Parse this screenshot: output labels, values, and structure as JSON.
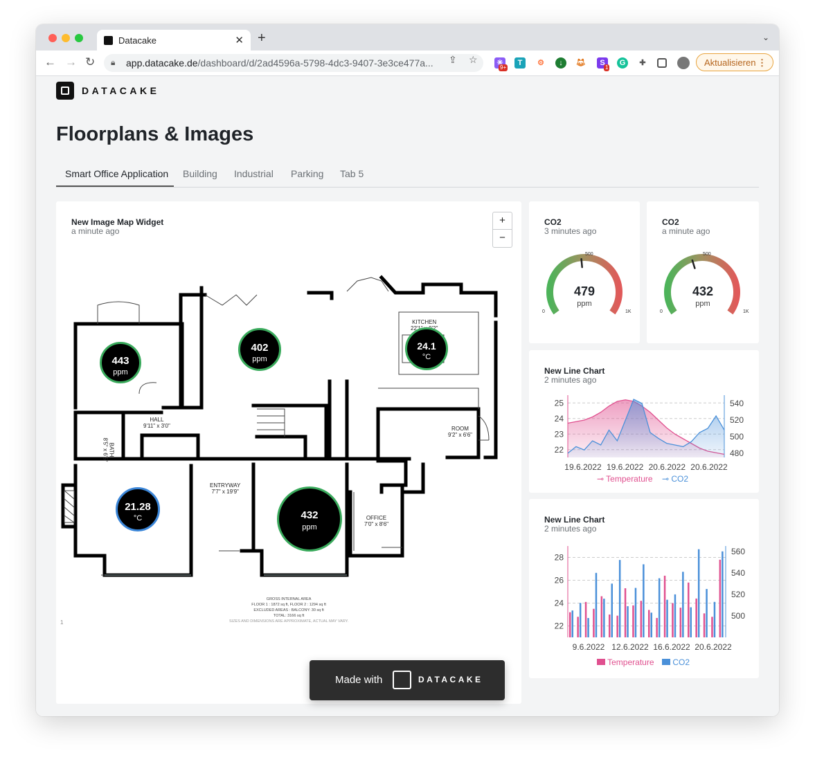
{
  "browser": {
    "tab_title": "Datacake",
    "url_host": "app.datacake.de",
    "url_path": "/dashboard/d/2ad4596a-5798-4dc3-9407-3e3ce477a...",
    "update_button": "Aktualisieren",
    "extension_badges": [
      "9+",
      "1"
    ]
  },
  "app": {
    "brand": "DATACAKE",
    "page_title": "Floorplans & Images",
    "tabs": [
      "Smart Office Application",
      "Building",
      "Industrial",
      "Parking",
      "Tab 5"
    ],
    "active_tab": "Smart Office Application"
  },
  "image_map": {
    "title": "New Image Map Widget",
    "subtitle": "a minute ago",
    "zoom_in": "+",
    "zoom_out": "−",
    "sensors": [
      {
        "value": "443",
        "unit": "ppm",
        "ring": "#3aaa5c"
      },
      {
        "value": "402",
        "unit": "ppm",
        "ring": "#3aaa5c"
      },
      {
        "value": "24.1",
        "unit": "°C",
        "ring": "#3aaa5c"
      },
      {
        "value": "21.28",
        "unit": "°C",
        "ring": "#3b86d8"
      },
      {
        "value": "432",
        "unit": "ppm",
        "ring": "#3aaa5c"
      }
    ],
    "room_labels": {
      "kitchen": "KITCHEN",
      "kitchen_dim": "22'1\" x 9'2\"",
      "hall": "HALL",
      "hall_dim": "9'11\" x 3'0\"",
      "bath": "BATH",
      "bath_dim": "8'5\" x 6'5\"",
      "room": "ROOM",
      "room_dim": "9'2\" x 6'6\"",
      "entry": "ENTRYWAY",
      "entry_dim": "7'7\" x 19'9\"",
      "office": "OFFICE",
      "office_dim": "7'0\" x 8'6\""
    },
    "area_notes": [
      "GROSS INTERNAL AREA",
      "FLOOR 1 : 1872 sq ft, FLOOR 2 : 1294 sq ft",
      "EXCLUDED AREAS : BALCONY: 30 sq ft",
      "TOTAL: 3166 sq ft",
      "SIZES AND DIMENSIONS ARE APPROXIMATE, ACTUAL MAY VARY."
    ],
    "page_marker": "1",
    "made_with": "Made with",
    "made_with_brand": "DATACAKE"
  },
  "gauges": [
    {
      "title": "CO2",
      "subtitle": "3 minutes ago",
      "value": 479,
      "unit": "ppm",
      "min": "0",
      "mid": "500",
      "max": "1K",
      "fraction": 0.479
    },
    {
      "title": "CO2",
      "subtitle": "a minute ago",
      "value": 432,
      "unit": "ppm",
      "min": "0",
      "mid": "500",
      "max": "1K",
      "fraction": 0.432
    }
  ],
  "line_chart": {
    "title": "New Line Chart",
    "subtitle": "2 minutes ago"
  },
  "bar_chart": {
    "title": "New Line Chart",
    "subtitle": "2 minutes ago"
  },
  "chart_data": [
    {
      "type": "area",
      "categories": [
        "19.6.2022",
        "19.6.2022",
        "20.6.2022",
        "20.6.2022"
      ],
      "y_left_ticks": [
        "25",
        "24",
        "23",
        "22"
      ],
      "y_right_ticks": [
        "540",
        "520",
        "500",
        "480"
      ],
      "ylim_left": [
        21.5,
        25.5
      ],
      "ylim_right": [
        475,
        550
      ],
      "legend_placement": "bottom",
      "series": [
        {
          "name": "Temperature",
          "axis": "left",
          "color": "#e0508f",
          "values": [
            23.7,
            23.8,
            23.9,
            24.1,
            24.4,
            24.8,
            25.1,
            25.2,
            25.1,
            24.8,
            24.4,
            23.9,
            23.4,
            23.0,
            22.7,
            22.4,
            22.1,
            21.9,
            21.8,
            21.7
          ]
        },
        {
          "name": "CO2",
          "axis": "right",
          "color": "#4a90d9",
          "values": [
            480,
            488,
            484,
            495,
            490,
            508,
            495,
            520,
            545,
            540,
            505,
            498,
            492,
            490,
            488,
            494,
            505,
            510,
            525,
            508
          ]
        }
      ]
    },
    {
      "type": "bar",
      "categories": [
        "9.6.2022",
        "12.6.2022",
        "16.6.2022",
        "20.6.2022"
      ],
      "y_left_ticks": [
        "28",
        "26",
        "24",
        "22"
      ],
      "y_right_ticks": [
        "560",
        "540",
        "520",
        "500"
      ],
      "ylim_left": [
        21,
        29
      ],
      "ylim_right": [
        480,
        565
      ],
      "legend_placement": "bottom",
      "series": [
        {
          "name": "Temperature",
          "axis": "left",
          "color": "#e0508f",
          "values": [
            23.2,
            22.8,
            24.1,
            23.5,
            24.6,
            23.0,
            22.9,
            25.3,
            23.8,
            24.2,
            23.4,
            22.7,
            26.4,
            24.0,
            23.6,
            25.8,
            24.4,
            23.1,
            22.8,
            27.8
          ]
        },
        {
          "name": "CO2",
          "axis": "right",
          "color": "#4a90d9",
          "values": [
            505,
            512,
            498,
            540,
            516,
            530,
            552,
            509,
            526,
            548,
            503,
            535,
            515,
            520,
            541,
            508,
            562,
            525,
            513,
            560
          ]
        }
      ]
    }
  ]
}
